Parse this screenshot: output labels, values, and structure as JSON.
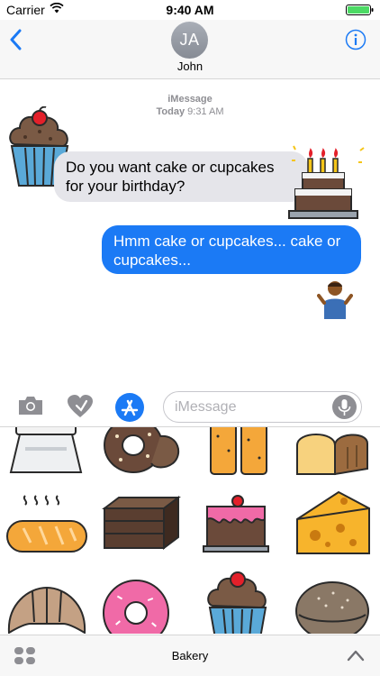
{
  "status_bar": {
    "carrier": "Carrier",
    "time": "9:40 AM"
  },
  "header": {
    "avatar_initials": "JA",
    "contact_name": "John"
  },
  "thread": {
    "service": "iMessage",
    "day": "Today",
    "time": "9:31 AM",
    "messages": [
      {
        "direction": "incoming",
        "text": "Do you want cake or cupcakes for your birthday?"
      },
      {
        "direction": "outgoing",
        "text": "Hmm cake or cupcakes... cake or cupcakes..."
      }
    ]
  },
  "input_bar": {
    "placeholder": "iMessage"
  },
  "drawer": {
    "pack_name": "Bakery",
    "stickers": [
      "flour-sack",
      "bagel",
      "biscuit-stack",
      "bread-loaf",
      "baguette",
      "brownie",
      "cake-slice",
      "cheese",
      "croissant",
      "donut",
      "cupcake",
      "bun"
    ]
  },
  "colors": {
    "accent": "#1b7af5",
    "incoming_bubble": "#e5e5ea",
    "outgoing_bubble": "#1b7af5",
    "bar_background": "#f7f7f7"
  }
}
